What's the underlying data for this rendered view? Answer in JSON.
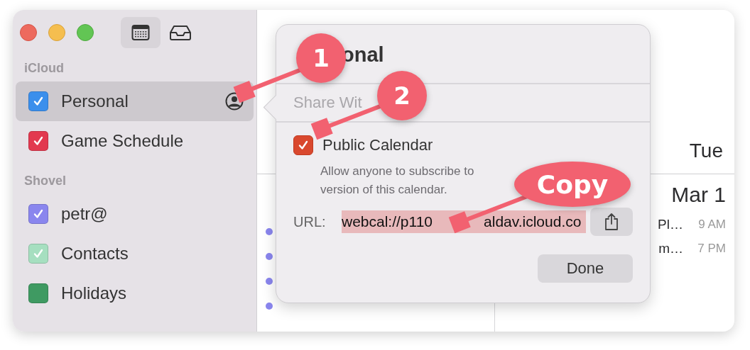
{
  "toolbar": [
    {
      "kind": "calendar",
      "selected": true
    },
    {
      "kind": "inbox",
      "selected": false
    }
  ],
  "sidebar": {
    "groups": [
      {
        "title": "iCloud",
        "calendars": [
          {
            "name": "Personal",
            "color": "#3b8fec",
            "checked": true,
            "selected": true,
            "shared": true
          },
          {
            "name": "Game Schedule",
            "color": "#e2394f",
            "checked": true,
            "selected": false,
            "shared": false
          }
        ]
      },
      {
        "title": "Shovel",
        "calendars": [
          {
            "name": "petr@",
            "color": "#8a86ee",
            "checked": true,
            "selected": false,
            "shared": false
          },
          {
            "name": "Contacts",
            "color": "#a6dfc0",
            "checked": true,
            "selected": false,
            "shared": false
          },
          {
            "name": "Holidays",
            "color": "#3f9a62",
            "checked": false,
            "selected": false,
            "shared": false
          }
        ]
      }
    ]
  },
  "calendar": {
    "day": "Tue",
    "date": "Mar 1",
    "list_events": [
      {
        "color": "#8a86ee"
      },
      {
        "color": "#8a86ee"
      },
      {
        "color": "#8a86ee"
      },
      {
        "color": "#8a86ee"
      }
    ],
    "day_events": [
      {
        "title": "Pl…",
        "time": "9 AM"
      },
      {
        "title": "m…",
        "time": "7 PM"
      }
    ]
  },
  "popover": {
    "title": "onal",
    "share_with": {
      "placeholder": "Share Wit"
    },
    "public_calendar": {
      "label": "Public Calendar",
      "checked": true
    },
    "description_lines": [
      "Allow anyone to subscribe to",
      "version of this calendar."
    ],
    "url_label": "URL:",
    "url_parts": [
      "webcal://p110",
      "aldav.icloud.co"
    ],
    "done": "Done"
  },
  "annotations": [
    {
      "kind": "number",
      "label": "1"
    },
    {
      "kind": "number",
      "label": "2"
    },
    {
      "kind": "callout",
      "label": "Copy"
    }
  ]
}
